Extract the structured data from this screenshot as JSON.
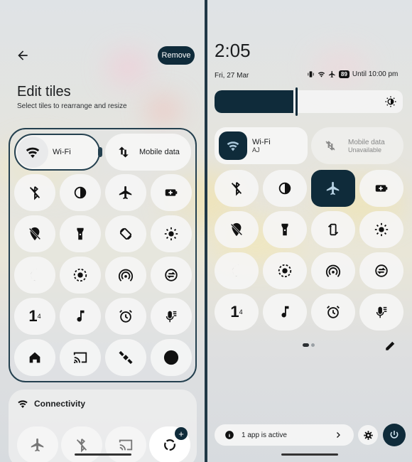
{
  "edit": {
    "title": "Edit tiles",
    "subtitle": "Select tiles to rearrange and resize",
    "remove_label": "Remove",
    "wifi_label": "Wi-Fi",
    "mobile_data_label": "Mobile data",
    "connectivity_label": "Connectivity",
    "row4_number": "1",
    "row4_sup": "4",
    "add_badge": "+"
  },
  "shade": {
    "time": "2:05",
    "date": "Fri, 27 Mar",
    "battery": "89",
    "alarm": "Until 10:00 pm",
    "wifi_label": "Wi-Fi",
    "wifi_sub": "AJ",
    "mobile_label": "Mobile data",
    "mobile_sub": "Unavailable",
    "row4_number": "1",
    "row4_sup": "4",
    "active_apps": "1 app is active",
    "brightness_level": 0.42
  },
  "colors": {
    "accent_dark": "#0f2b3a",
    "tile_bg": "#f6f6f6",
    "text": "#1b1d1f"
  }
}
